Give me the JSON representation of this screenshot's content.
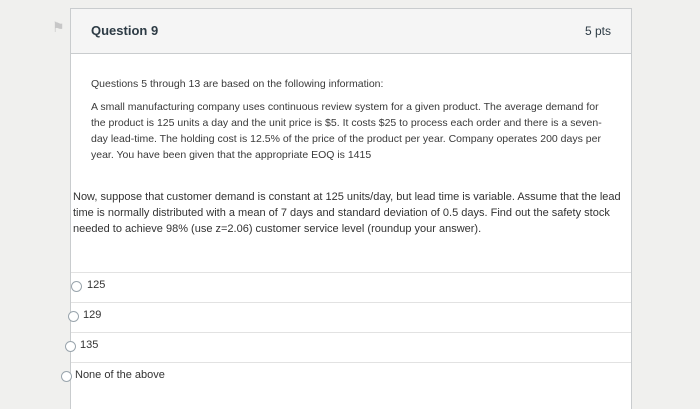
{
  "question": {
    "title": "Question 9",
    "points": "5 pts",
    "intro_heading": "Questions 5 through 13 are based on the following information:",
    "intro_text": "A small manufacturing company uses continuous review system for a given product. The average demand for the product is 125 units a day and the unit price is $5. It costs $25 to process each order and there is a seven-day lead-time. The holding cost is 12.5% of the price of the product per year. Company operates 200 days per year. You have been given that the appropriate EOQ is 1415",
    "prompt": "Now, suppose that customer demand is constant at 125 units/day, but lead time is variable. Assume that the lead time is normally distributed with a mean of 7 days and standard deviation of 0.5 days. Find out the safety stock needed to achieve 98% (use z=2.06) customer service level (roundup your answer).",
    "options": [
      {
        "label": "125"
      },
      {
        "label": "129"
      },
      {
        "label": "135"
      },
      {
        "label": "None of the above"
      }
    ]
  }
}
